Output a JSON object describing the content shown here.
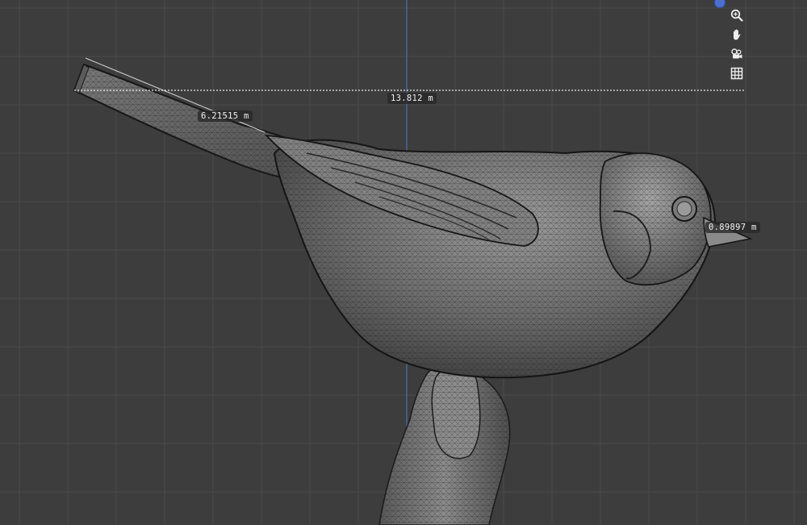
{
  "viewport": {
    "background": "#3d3d3d",
    "grid_color": "#4a4a4a",
    "axis_color": "#4f6fae"
  },
  "measurements": {
    "width_label": "13.812 m",
    "tail_label": "6.21515 m",
    "beak_label": "0.89897 m"
  },
  "navigation_gizmo": {
    "items": [
      {
        "icon": "zoom-icon"
      },
      {
        "icon": "hand-pan-icon"
      },
      {
        "icon": "camera-orbit-icon"
      },
      {
        "icon": "grid-ortho-icon"
      }
    ]
  }
}
